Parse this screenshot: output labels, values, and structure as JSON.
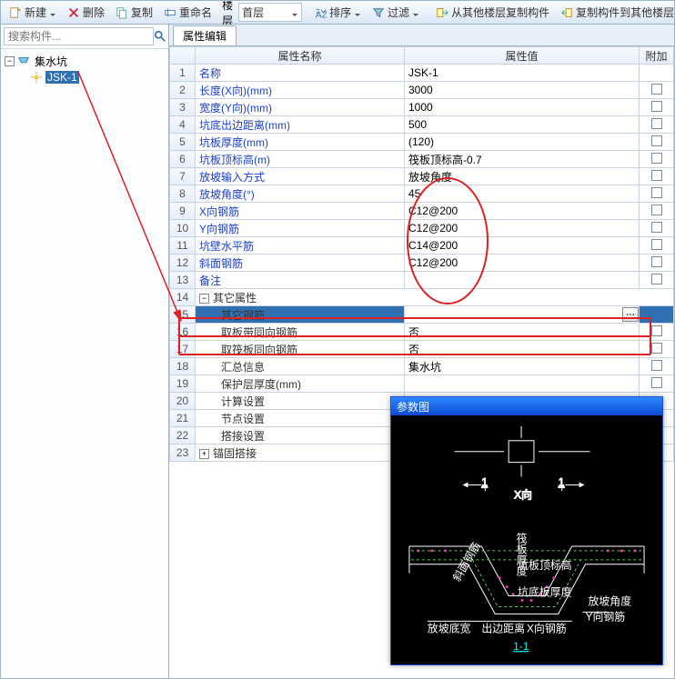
{
  "toolbar": {
    "new": "新建",
    "delete": "删除",
    "copy": "复制",
    "rename": "重命名",
    "floor": "楼层",
    "first_floor": "首层",
    "sort": "排序",
    "filter": "过滤",
    "copy_from": "从其他楼层复制构件",
    "copy_to": "复制构件到其他楼层"
  },
  "search": {
    "placeholder": "搜索构件..."
  },
  "tree": {
    "root": "集水坑",
    "child": "JSK-1"
  },
  "tab": {
    "label": "属性编辑"
  },
  "columns": {
    "name": "属性名称",
    "value": "属性值",
    "attach": "附加"
  },
  "rows": [
    {
      "n": "1",
      "name": "名称",
      "val": "JSK-1",
      "link": true,
      "chk": false
    },
    {
      "n": "2",
      "name": "长度(X向)(mm)",
      "val": "3000",
      "link": true,
      "chk": true
    },
    {
      "n": "3",
      "name": "宽度(Y向)(mm)",
      "val": "1000",
      "link": true,
      "chk": true
    },
    {
      "n": "4",
      "name": "坑底出边距离(mm)",
      "val": "500",
      "link": true,
      "chk": true
    },
    {
      "n": "5",
      "name": "坑板厚度(mm)",
      "val": "(120)",
      "link": true,
      "chk": true
    },
    {
      "n": "6",
      "name": "坑板顶标高(m)",
      "val": "筏板顶标高-0.7",
      "link": true,
      "chk": true
    },
    {
      "n": "7",
      "name": "放坡输入方式",
      "val": "放坡角度",
      "link": true,
      "chk": true
    },
    {
      "n": "8",
      "name": "放坡角度(°)",
      "val": "45",
      "link": true,
      "chk": true
    },
    {
      "n": "9",
      "name": "X向钢筋",
      "val": "C12@200",
      "link": true,
      "chk": true
    },
    {
      "n": "10",
      "name": "Y向钢筋",
      "val": "C12@200",
      "link": true,
      "chk": true
    },
    {
      "n": "11",
      "name": "坑壁水平筋",
      "val": "C14@200",
      "link": true,
      "chk": true
    },
    {
      "n": "12",
      "name": "斜面钢筋",
      "val": "C12@200",
      "link": true,
      "chk": true
    },
    {
      "n": "13",
      "name": "备注",
      "val": "",
      "link": true,
      "chk": true
    },
    {
      "n": "14",
      "name": "其它属性",
      "val": "",
      "group": true,
      "expanded": true
    },
    {
      "n": "15",
      "name": "其它钢筋",
      "val": "",
      "link": false,
      "selected": true,
      "editor": true
    },
    {
      "n": "16",
      "name": "取板带同向钢筋",
      "val": "否",
      "link": false,
      "chk": true
    },
    {
      "n": "17",
      "name": "取筏板同向钢筋",
      "val": "否",
      "link": false,
      "chk": true
    },
    {
      "n": "18",
      "name": "汇总信息",
      "val": "集水坑",
      "link": false,
      "chk": true
    },
    {
      "n": "19",
      "name": "保护层厚度(mm)",
      "val": "",
      "link": false,
      "chk": true
    },
    {
      "n": "20",
      "name": "计算设置",
      "val": "",
      "link": false
    },
    {
      "n": "21",
      "name": "节点设置",
      "val": "",
      "link": false
    },
    {
      "n": "22",
      "name": "搭接设置",
      "val": "",
      "link": false
    },
    {
      "n": "23",
      "name": "锚固搭接",
      "val": "",
      "group": true,
      "expanded": false
    }
  ],
  "param": {
    "title": "参数图",
    "labels": {
      "xdir": "X向",
      "one": "1",
      "section": "1-1",
      "top": "坑板顶标高",
      "thick": "坑底板厚度",
      "angle": "放坡角度",
      "bottomw": "放坡底宽",
      "edge": "出边距离",
      "xbar": "X向钢筋",
      "ybar": "Y向钢筋"
    }
  }
}
